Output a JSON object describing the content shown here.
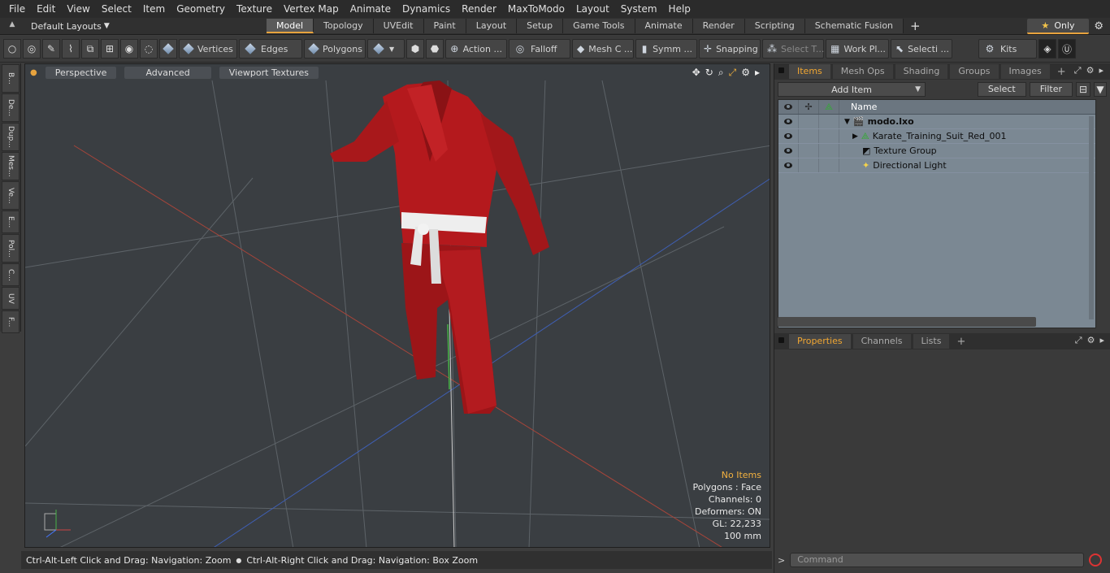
{
  "menu": [
    "File",
    "Edit",
    "View",
    "Select",
    "Item",
    "Geometry",
    "Texture",
    "Vertex Map",
    "Animate",
    "Dynamics",
    "Render",
    "MaxToModo",
    "Layout",
    "System",
    "Help"
  ],
  "layouts": {
    "label": "Default Layouts"
  },
  "tabs": [
    "Model",
    "Topology",
    "UVEdit",
    "Paint",
    "Layout",
    "Setup",
    "Game Tools",
    "Animate",
    "Render",
    "Scripting",
    "Schematic Fusion"
  ],
  "active_tab": "Model",
  "only_label": "Only",
  "toolbar": {
    "vertices": "Vertices",
    "edges": "Edges",
    "polygons": "Polygons",
    "action": "Action ...",
    "falloff": "Falloff",
    "meshc": "Mesh C ...",
    "symm": "Symm ...",
    "snapping": "Snapping",
    "selectt": "Select T...",
    "workpl": "Work Pl...",
    "selecti": "Selecti ...",
    "kits": "Kits"
  },
  "left_tabs": [
    "B...",
    "De...",
    "Dup...",
    "Mes...",
    "Ve...",
    "E...",
    "Pol...",
    "C...",
    "UV",
    "F..."
  ],
  "viewport": {
    "view": "Perspective",
    "shading": "Advanced",
    "textures": "Viewport Textures",
    "hud": {
      "items": "No Items",
      "polygons": "Polygons : Face",
      "channels": "Channels: 0",
      "deformers": "Deformers: ON",
      "gl": "GL: 22,233",
      "unit": "100 mm"
    }
  },
  "status": {
    "left": "Ctrl-Alt-Left Click and Drag: Navigation: Zoom",
    "right": "Ctrl-Alt-Right Click and Drag: Navigation: Box Zoom"
  },
  "items_panel": {
    "tabs": [
      "Items",
      "Mesh Ops",
      "Shading",
      "Groups",
      "Images"
    ],
    "add_item": "Add Item",
    "select": "Select",
    "filter": "Filter",
    "col_name": "Name",
    "rows": [
      {
        "name": "modo.lxo"
      },
      {
        "name": "Karate_Training_Suit_Red_001"
      },
      {
        "name": "Texture Group"
      },
      {
        "name": "Directional Light"
      }
    ]
  },
  "props_panel": {
    "tabs": [
      "Properties",
      "Channels",
      "Lists"
    ]
  },
  "command": {
    "placeholder": "Command"
  },
  "colors": {
    "accent": "#e7a33e",
    "suit": "#b3191c",
    "belt": "#f2f2f2"
  }
}
